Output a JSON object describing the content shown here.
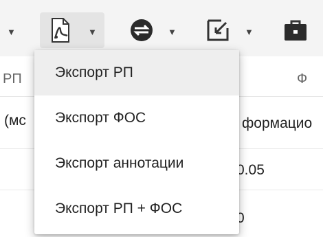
{
  "toolbar": {
    "buttons": [
      {
        "icon": "caret-down-icon"
      },
      {
        "icon": "pdf-export-icon"
      },
      {
        "icon": "sync-icon"
      },
      {
        "icon": "export-arrow-icon"
      },
      {
        "icon": "briefcase-icon"
      }
    ]
  },
  "table": {
    "header": {
      "col1": "РП",
      "col3": "Ф"
    },
    "rows": [
      {
        "col1": "(мс",
        "col2": "формацио"
      },
      {
        "col1": "",
        "col2": "0.05"
      },
      {
        "col1": "",
        "col2": "0"
      }
    ]
  },
  "export_menu": {
    "items": [
      {
        "label": "Экспорт РП"
      },
      {
        "label": "Экспорт ФОС"
      },
      {
        "label": "Экспорт аннотации"
      },
      {
        "label": "Экспорт РП + ФОС"
      }
    ]
  }
}
